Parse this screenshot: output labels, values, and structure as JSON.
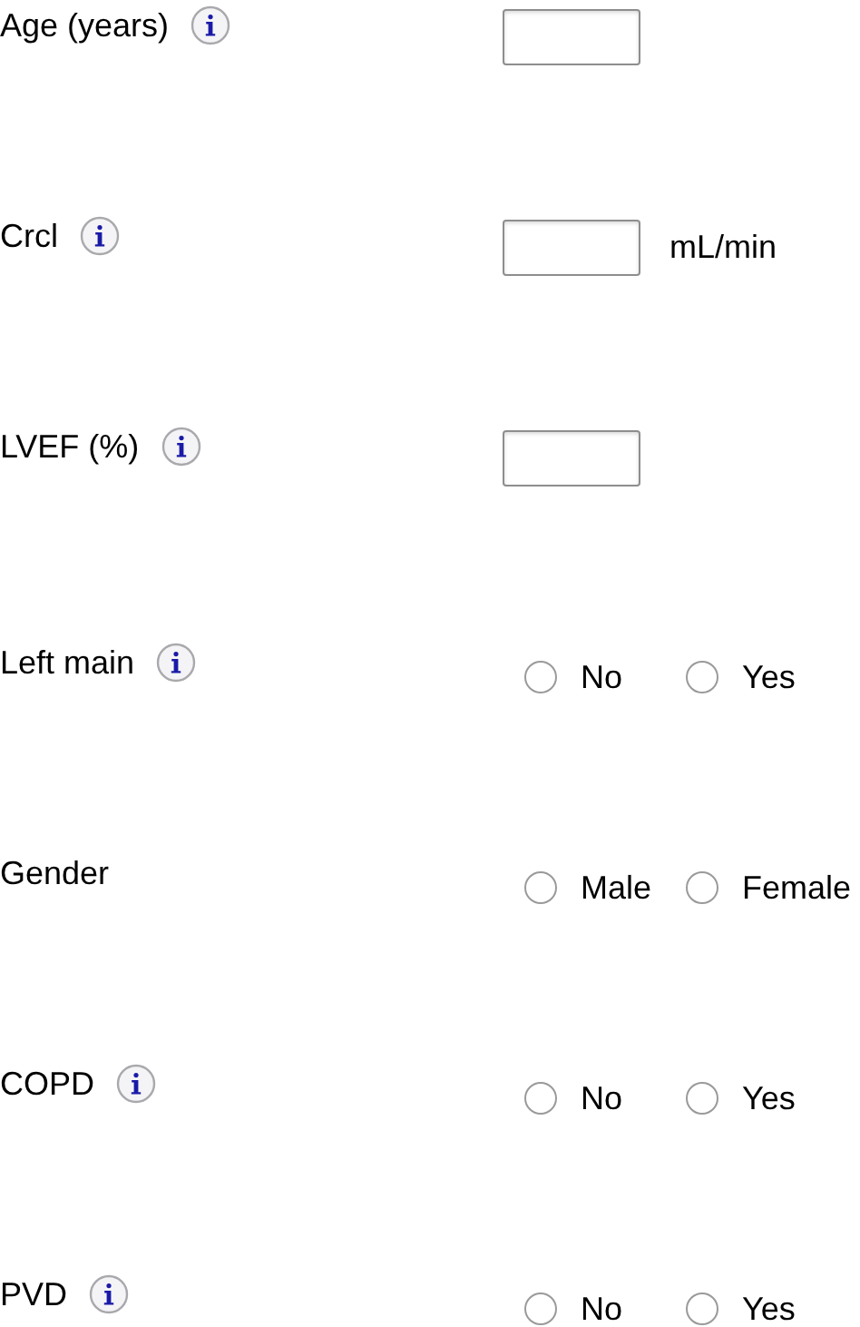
{
  "fields": [
    {
      "label": "Age (years)",
      "info": true,
      "kind": "input"
    },
    {
      "label": "Crcl",
      "info": true,
      "kind": "input",
      "unit": "mL/min"
    },
    {
      "label": "LVEF (%)",
      "info": true,
      "kind": "input"
    },
    {
      "label": "Left main",
      "info": true,
      "kind": "radio",
      "options": [
        {
          "label": "No",
          "selected": false
        },
        {
          "label": "Yes",
          "selected": false
        }
      ]
    },
    {
      "label": "Gender",
      "info": false,
      "kind": "radio",
      "options": [
        {
          "label": "Male",
          "selected": false
        },
        {
          "label": "Female",
          "selected": false
        }
      ]
    },
    {
      "label": "COPD",
      "info": true,
      "kind": "radio",
      "options": [
        {
          "label": "No",
          "selected": false
        },
        {
          "label": "Yes",
          "selected": false
        }
      ]
    },
    {
      "label": "PVD",
      "info": true,
      "kind": "radio",
      "options": [
        {
          "label": "No",
          "selected": false
        },
        {
          "label": "Yes",
          "selected": false
        }
      ]
    }
  ]
}
